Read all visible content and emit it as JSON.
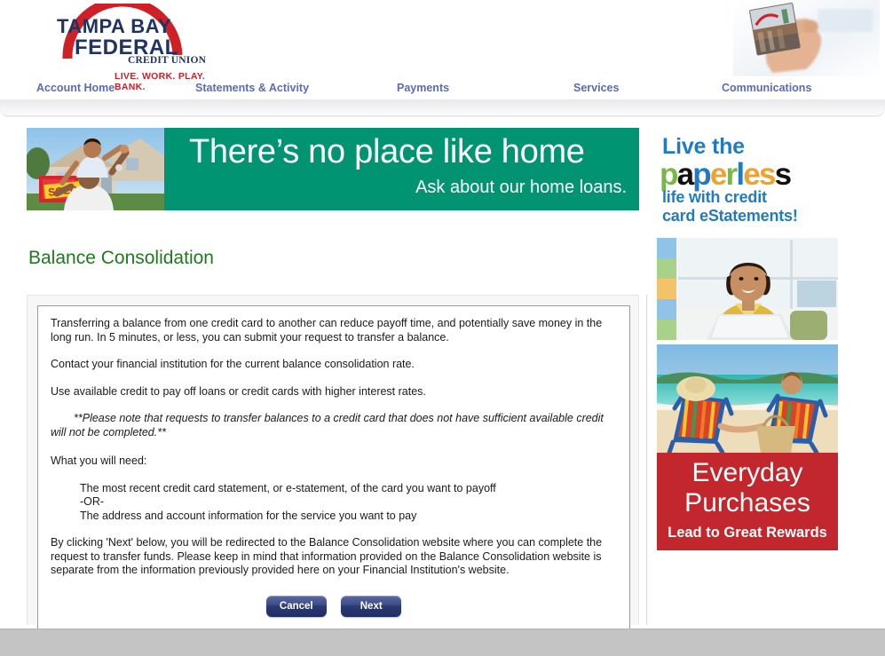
{
  "brand": {
    "logo_line1": "TAMPA BAY",
    "logo_line2": "FEDERAL",
    "logo_line3": "CREDIT UNION",
    "logo_tagline": "LIVE. WORK. PLAY. BANK.",
    "navy": "#1f3364",
    "red": "#cf2027",
    "green": "#1e7a1e"
  },
  "nav": {
    "items": [
      {
        "label": "Account Home"
      },
      {
        "label": "Statements & Activity"
      },
      {
        "label": "Payments"
      },
      {
        "label": "Services"
      },
      {
        "label": "Communications"
      }
    ]
  },
  "hero": {
    "headline": "There’s no place like home",
    "subline": "Ask about our home loans.",
    "bg_color": "#009473",
    "photo_alt": "father-and-son-in-front-of-sold-home"
  },
  "main": {
    "title": "Balance Consolidation",
    "paragraphs": {
      "p1": "Transferring a balance from one credit card to another can reduce payoff time, and potentially save money in the long run. In 5 minutes, or less, you can submit your request to transfer a balance.",
      "p2": "Contact your financial institution for the current balance consolidation rate.",
      "p3": "Use available credit to pay off loans or credit cards with higher interest rates.",
      "note": "**Please note that requests to transfer balances to a credit card that does not have sufficient available credit will not be completed.**",
      "need_heading": "What you will need:",
      "need_item1": "The most recent credit card statement, or e-statement, of the card you want to payoff",
      "need_or": "-OR-",
      "need_item2": "The address and account information for the service you want to pay",
      "p_final": "By clicking 'Next' below, you will be redirected to the Balance Consolidation website where you can complete the request to transfer funds. Please keep in mind that information provided on the Balance Consolidation website is separate from the information previously provided here on your Financial Institution's website."
    },
    "buttons": {
      "cancel": "Cancel",
      "next": "Next"
    }
  },
  "sidebar": {
    "paperless_ad": {
      "line1": "Live the",
      "word": "paperless",
      "letters": [
        {
          "ch": "p",
          "color": "#7ab648"
        },
        {
          "ch": "a",
          "color": "#111111"
        },
        {
          "ch": "p",
          "color": "#1f7cc3"
        },
        {
          "ch": "e",
          "color": "#f0a22e"
        },
        {
          "ch": "r",
          "color": "#7ab648"
        },
        {
          "ch": "l",
          "color": "#1f7cc3"
        },
        {
          "ch": "e",
          "color": "#f0a22e"
        },
        {
          "ch": "s",
          "color": "#f0a22e"
        },
        {
          "ch": "s",
          "color": "#111111"
        }
      ],
      "line3a": "life with credit",
      "line3b": "card eStatements!"
    },
    "woman_photo_alt": "smiling-woman-using-laptop",
    "beach_photo_alt": "couple-in-beach-chairs-holding-hands",
    "rewards_ad": {
      "line1": "Everyday",
      "line2": "Purchases",
      "line3": "Lead to Great Rewards",
      "bg_color": "#c1272d"
    }
  }
}
